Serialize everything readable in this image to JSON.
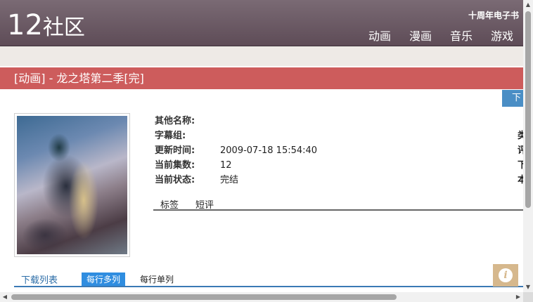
{
  "header": {
    "logo_number": "12",
    "logo_text": "社区",
    "anniversary": "十周年电子书",
    "nav": [
      "动画",
      "漫画",
      "音乐",
      "游戏"
    ]
  },
  "title_bar": {
    "text": "[动画] - 龙之塔第二季[完]"
  },
  "download_tab": {
    "label": "下"
  },
  "info": {
    "rows": [
      {
        "label": "其他名称:",
        "value": ""
      },
      {
        "label": "字幕组:",
        "value": ""
      },
      {
        "label": "更新时间:",
        "value": "2009-07-18 15:54:40"
      },
      {
        "label": "当前集数:",
        "value": "12"
      },
      {
        "label": "当前状态:",
        "value": "完结"
      }
    ],
    "right_column_fragments": [
      "类",
      "评",
      "下",
      "本"
    ]
  },
  "subtabs": [
    "标签",
    "短评"
  ],
  "download_list": {
    "label": "下载列表",
    "multi_button": "每行多列",
    "single_button": "每行单列"
  },
  "icons": {
    "info": "info-icon",
    "scroll_up": "arrow-up-icon",
    "scroll_down": "arrow-down-icon",
    "scroll_left": "arrow-left-icon",
    "scroll_right": "arrow-right-icon"
  },
  "colors": {
    "header_bg": "#6b5963",
    "title_bar_bg": "#cd5c5c",
    "download_tab_bg": "#4a8ec5",
    "accent_blue": "#2f8de0",
    "info_button_bg": "#d6b88d"
  }
}
